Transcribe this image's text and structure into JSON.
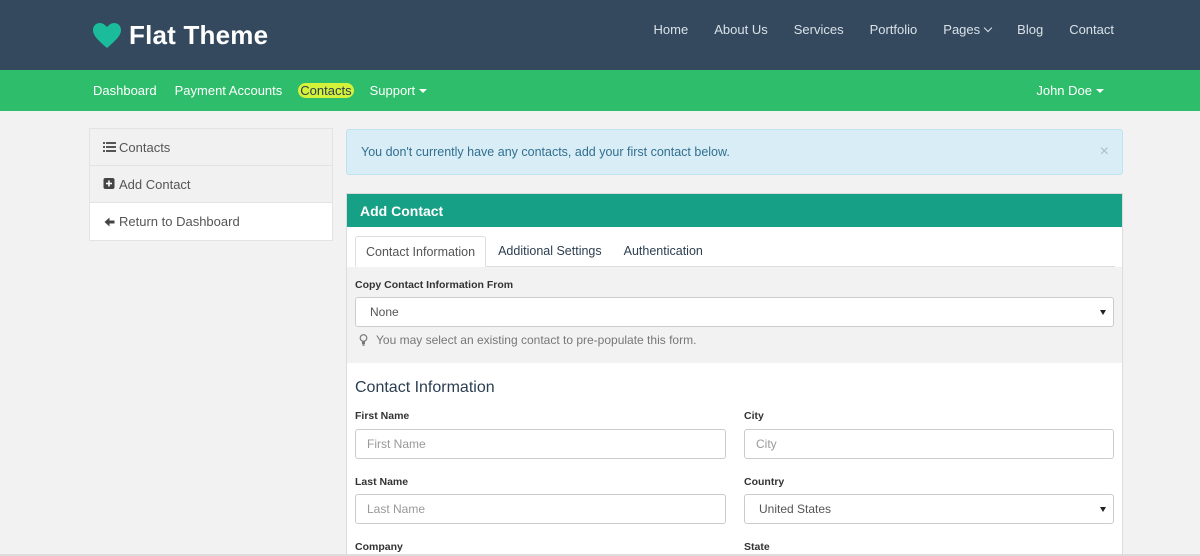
{
  "brand": {
    "name": "Flat Theme",
    "icon": "heart-icon",
    "color": "#1abc9c"
  },
  "main_nav": [
    {
      "label": "Home"
    },
    {
      "label": "About Us"
    },
    {
      "label": "Services"
    },
    {
      "label": "Portfolio"
    },
    {
      "label": "Pages",
      "dropdown": true
    },
    {
      "label": "Blog"
    },
    {
      "label": "Contact"
    }
  ],
  "sub_nav": [
    {
      "label": "Dashboard"
    },
    {
      "label": "Payment Accounts"
    },
    {
      "label": "Contacts",
      "active": true
    },
    {
      "label": "Support",
      "dropdown": true
    }
  ],
  "user_menu": {
    "label": "John Doe"
  },
  "sidebar": [
    {
      "label": "Contacts",
      "icon": "list-icon"
    },
    {
      "label": "Add Contact",
      "icon": "plus-square-icon"
    },
    {
      "label": "Return to Dashboard",
      "icon": "arrow-left-icon"
    }
  ],
  "alert": {
    "message": "You don't currently have any contacts, add your first contact below.",
    "close": "×"
  },
  "panel": {
    "title": "Add Contact",
    "tabs": [
      {
        "label": "Contact Information",
        "active": true
      },
      {
        "label": "Additional Settings"
      },
      {
        "label": "Authentication"
      }
    ],
    "copy": {
      "label": "Copy Contact Information From",
      "selected": "None",
      "help": "You may select an existing contact to pre-populate this form."
    },
    "section_title": "Contact Information",
    "fields": {
      "first_name": {
        "label": "First Name",
        "placeholder": "First Name"
      },
      "city": {
        "label": "City",
        "placeholder": "City"
      },
      "last_name": {
        "label": "Last Name",
        "placeholder": "Last Name"
      },
      "country": {
        "label": "Country",
        "selected": "United States"
      },
      "company": {
        "label": "Company"
      },
      "state": {
        "label": "State"
      }
    }
  },
  "colors": {
    "header": "#34495e",
    "subnav": "#2ebd6b",
    "panel_header": "#16a085",
    "active_highlight": "#d4f23a"
  }
}
